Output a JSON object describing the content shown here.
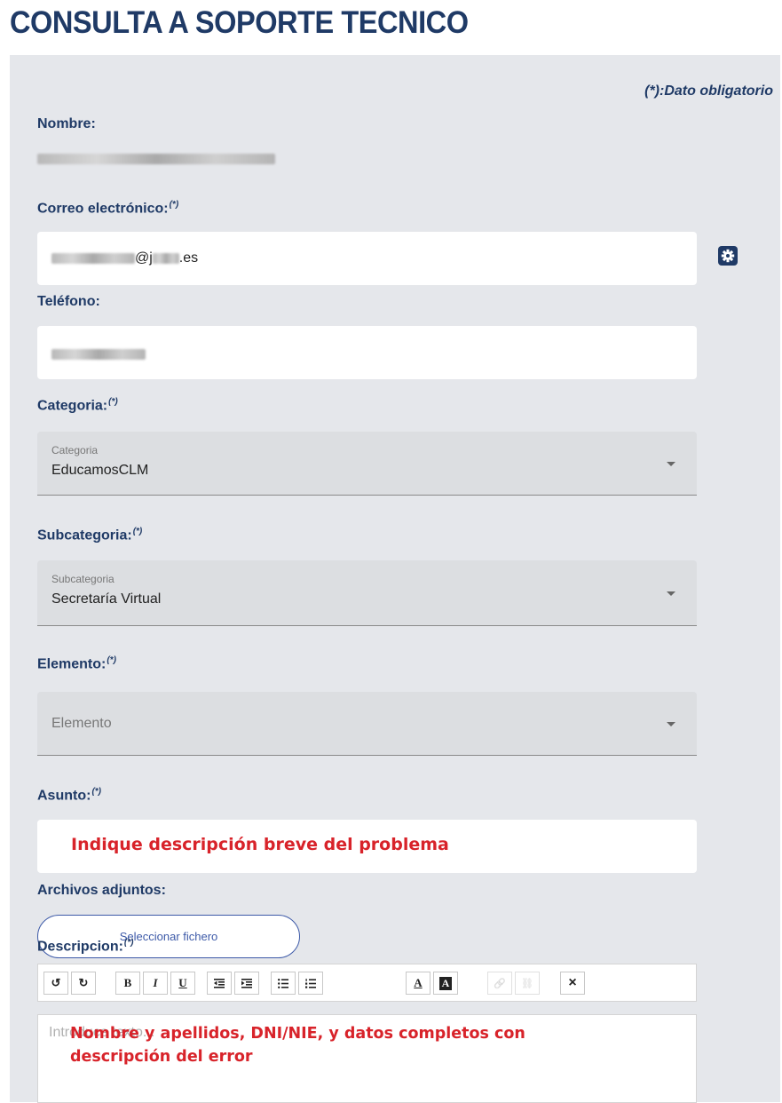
{
  "page": {
    "title": "CONSULTA A SOPORTE TECNICO"
  },
  "form": {
    "required_note": "(*):Dato obligatorio",
    "required_mark": "(*)",
    "nombre": {
      "label": "Nombre:"
    },
    "email": {
      "label": "Correo electrónico:",
      "value_mid": "@j",
      "value_end": ".es"
    },
    "telefono": {
      "label": "Teléfono:"
    },
    "categoria": {
      "label": "Categoria:",
      "float_label": "Categoria",
      "value": "EducamosCLM"
    },
    "subcategoria": {
      "label": "Subcategoria:",
      "float_label": "Subcategoria",
      "value": "Secretaría Virtual"
    },
    "elemento": {
      "label": "Elemento:",
      "placeholder": "Elemento"
    },
    "asunto": {
      "label": "Asunto:",
      "value": "Indique descripción breve del problema"
    },
    "adjuntos": {
      "label": "Archivos adjuntos:",
      "button": "Seleccionar fichero"
    },
    "descripcion": {
      "label": "Descripcion:",
      "placeholder": "Introduce texto...",
      "overlay_line1": "Nombre y apellidos, DNI/NIE, y datos completos con",
      "overlay_line2": "descripción del error"
    }
  },
  "toolbar": {
    "undo_glyph": "↺",
    "redo_glyph": "↻",
    "bold": "B",
    "italic": "I",
    "underline": "U",
    "font_color": "A",
    "bg_color": "A",
    "link_glyph": "🔗",
    "unlink_glyph": "⛓",
    "clear": "×"
  },
  "colors": {
    "heading": "#1f3a66",
    "accent_red": "#d8232a",
    "panel": "#e5e7eb",
    "button_border": "#3d5aa8"
  }
}
